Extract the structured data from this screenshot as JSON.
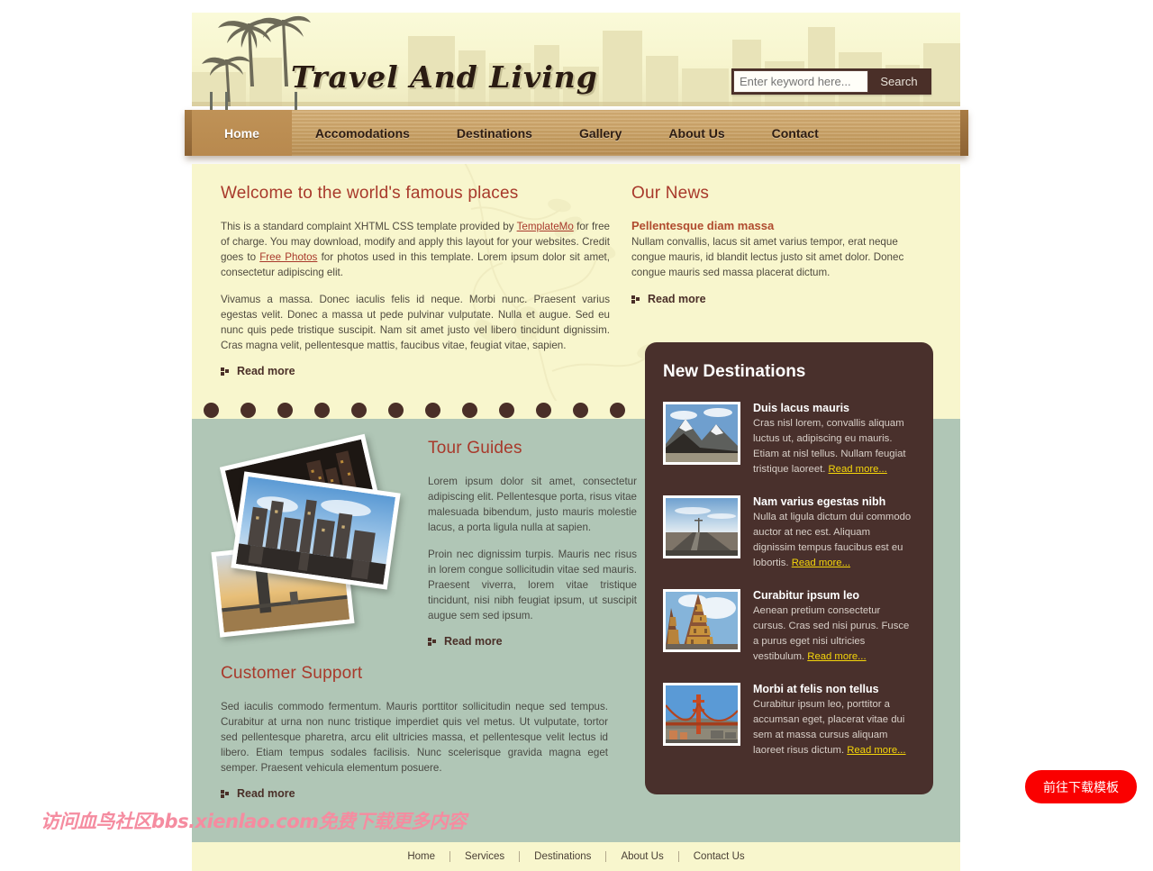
{
  "site": {
    "logo_text": "Travel And Living",
    "accent_color": "#a8392b",
    "plank_color": "#c49d61",
    "panel_color": "#49302c",
    "cream_color": "#f8f6cd",
    "green_color": "#b0c6b6"
  },
  "search": {
    "placeholder": "Enter keyword here...",
    "value": "",
    "button_label": "Search"
  },
  "nav": {
    "items": [
      {
        "label": "Home",
        "active": true
      },
      {
        "label": "Accomodations",
        "active": false
      },
      {
        "label": "Destinations",
        "active": false
      },
      {
        "label": "Gallery",
        "active": false
      },
      {
        "label": "About Us",
        "active": false
      },
      {
        "label": "Contact",
        "active": false
      }
    ]
  },
  "welcome": {
    "title": "Welcome to the world's famous places",
    "p1_a": "This is a standard complaint XHTML CSS template provided by ",
    "p1_link1": "TemplateMo",
    "p1_b": " for free of charge. You may download, modify and apply this layout for your websites. Credit goes to ",
    "p1_link2": "Free Photos",
    "p1_c": " for photos used in this template. Lorem ipsum dolor sit amet, consectetur adipiscing elit.",
    "p2": "Vivamus a massa. Donec iaculis felis id neque. Morbi nunc. Praesent varius egestas velit. Donec a massa ut pede pulvinar vulputate. Nulla et augue. Sed eu nunc quis pede tristique suscipit. Nam sit amet justo vel libero tincidunt dignissim. Cras magna velit, pellentesque mattis, faucibus vitae, feugiat vitae, sapien.",
    "read_more": "Read more"
  },
  "news": {
    "title": "Our News",
    "headline": "Pellentesque diam massa",
    "body": "Nullam convallis, lacus sit amet varius tempor, erat neque congue mauris, id blandit lectus justo sit amet dolor. Donec congue mauris sed massa placerat dictum.",
    "read_more": "Read more"
  },
  "destinations": {
    "title": "New Destinations",
    "read_more_label": "Read more...",
    "items": [
      {
        "title": "Duis lacus mauris",
        "body": "Cras nisl lorem, convallis aliquam luctus ut, adipiscing eu mauris. Etiam at nisl tellus. Nullam feugiat tristique laoreet. ",
        "image": "snow-mountain-photo"
      },
      {
        "title": "Nam varius egestas nibh",
        "body": "Nulla at ligula dictum dui commodo auctor at nec est. Aliquam dignissim tempus faucibus est eu lobortis. ",
        "image": "desert-road-photo"
      },
      {
        "title": "Curabitur ipsum leo",
        "body": "Aenean pretium consectetur cursus. Cras sed nisi purus. Fusce a purus eget nisi ultricies vestibulum. ",
        "image": "temple-spires-photo"
      },
      {
        "title": "Morbi at felis non tellus",
        "body": "Curabitur ipsum leo, porttitor a accumsan eget, placerat vitae dui sem at massa cursus aliquam laoreet risus dictum. ",
        "image": "golden-gate-bridge-photo"
      }
    ]
  },
  "tour_guides": {
    "title": "Tour Guides",
    "p1": "Lorem ipsum dolor sit amet, consectetur adipiscing elit. Pellentesque porta, risus vitae malesuada bibendum, justo mauris molestie lacus, a porta ligula nulla at sapien.",
    "p2": "Proin nec dignissim turpis. Mauris nec risus in lorem congue sollicitudin vitae sed mauris. Praesent viverra, lorem vitae tristique tincidunt, nisi nibh feugiat ipsum, ut suscipit augue sem sed ipsum.",
    "read_more": "Read more"
  },
  "customer_support": {
    "title": "Customer Support",
    "body": "Sed iaculis commodo fermentum. Mauris porttitor sollicitudin neque sed tempus. Curabitur at urna non nunc tristique imperdiet quis vel metus. Ut vulputate, tortor sed pellentesque pharetra, arcu elit ultricies massa, et pellentesque velit lectus id libero. Etiam tempus sodales facilisis. Nunc scelerisque gravida magna eget semper. Praesent vehicula elementum posuere.",
    "read_more": "Read more"
  },
  "footer": {
    "links": [
      "Home",
      "Services",
      "Destinations",
      "About Us",
      "Contact Us"
    ]
  },
  "overlay": {
    "watermark": "访问血鸟社区bbs.xienlao.com免费下载更多内容",
    "download_button": "前往下载模板",
    "download_button_color": "#fa0000",
    "watermark_color": "#f58ca0"
  },
  "dots": {
    "count": 13,
    "color": "#4a2f28"
  }
}
